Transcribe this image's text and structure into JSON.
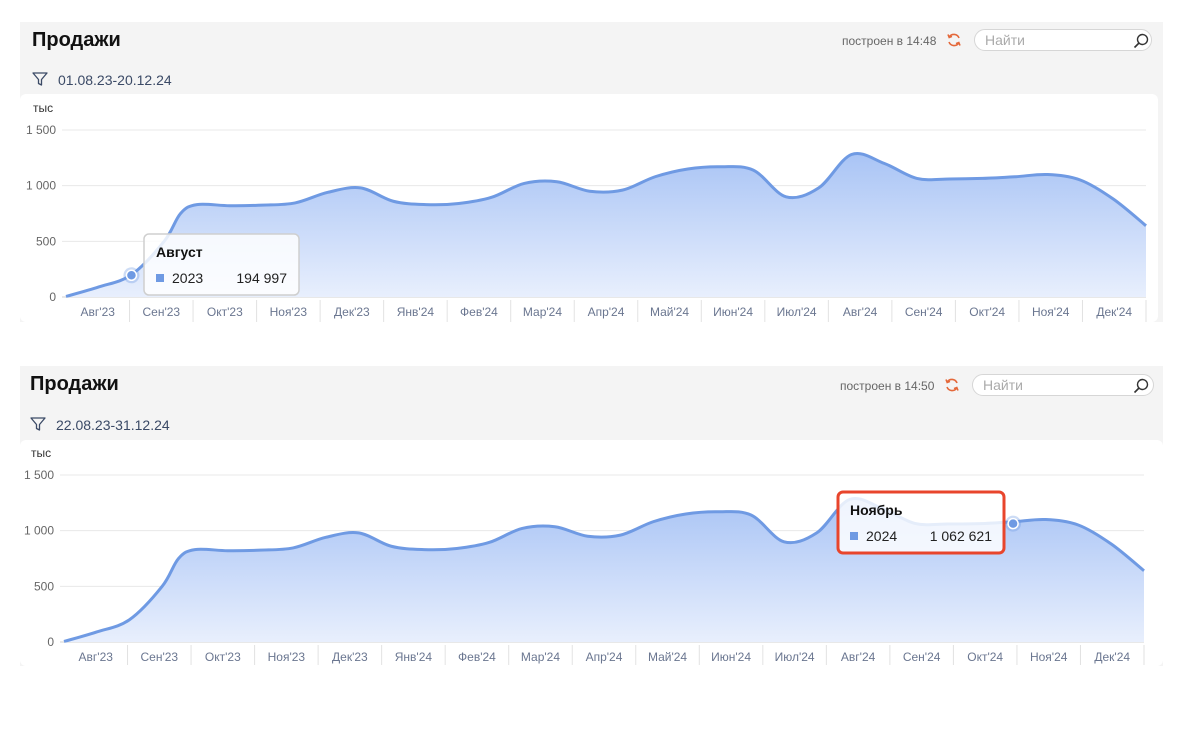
{
  "panels": [
    {
      "title": "Продажи",
      "built_label": "построен в 14:48",
      "search": {
        "placeholder": "Найти",
        "icon": "search-icon"
      },
      "refresh_icon": "refresh-icon",
      "filter_icon": "filter-icon",
      "date_range": "01.08.23-20.12.24",
      "tooltip": {
        "title": "Август",
        "series": "2023",
        "value": "194 997",
        "highlighted": false
      }
    },
    {
      "title": "Продажи",
      "built_label": "построен в 14:50",
      "search": {
        "placeholder": "Найти",
        "icon": "search-icon"
      },
      "refresh_icon": "refresh-icon",
      "filter_icon": "filter-icon",
      "date_range": "22.08.23-31.12.24",
      "tooltip": {
        "title": "Ноябрь",
        "series": "2024",
        "value": "1 062 621",
        "highlighted": true
      }
    }
  ],
  "colors": {
    "line": "#6f9ae3",
    "fill_top": "#a9c4f5",
    "fill_bottom": "#e8effd",
    "accent_refresh": "#e4683a",
    "highlight_border": "#e8452c"
  },
  "chart_data": [
    {
      "type": "area",
      "unit_label": "тыс",
      "categories": [
        "Авг'23",
        "Сен'23",
        "Окт'23",
        "Ноя'23",
        "Дек'23",
        "Янв'24",
        "Фев'24",
        "Мар'24",
        "Апр'24",
        "Май'24",
        "Июн'24",
        "Июл'24",
        "Авг'24",
        "Сен'24",
        "Окт'24",
        "Ноя'24",
        "Дек'24"
      ],
      "y_ticks": [
        "0",
        "500",
        "1 000",
        "1 500"
      ],
      "ylim": [
        0,
        1500
      ],
      "points": [
        {
          "x": 0.0,
          "y": 5
        },
        {
          "x": 0.5,
          "y": 90
        },
        {
          "x": 1.0,
          "y": 200
        },
        {
          "x": 1.5,
          "y": 500
        },
        {
          "x": 1.75,
          "y": 750
        },
        {
          "x": 2.0,
          "y": 830
        },
        {
          "x": 2.5,
          "y": 820
        },
        {
          "x": 3.0,
          "y": 825
        },
        {
          "x": 3.5,
          "y": 845
        },
        {
          "x": 4.0,
          "y": 940
        },
        {
          "x": 4.5,
          "y": 980
        },
        {
          "x": 5.0,
          "y": 860
        },
        {
          "x": 5.5,
          "y": 830
        },
        {
          "x": 6.0,
          "y": 840
        },
        {
          "x": 6.5,
          "y": 895
        },
        {
          "x": 7.0,
          "y": 1020
        },
        {
          "x": 7.5,
          "y": 1035
        },
        {
          "x": 8.0,
          "y": 950
        },
        {
          "x": 8.5,
          "y": 960
        },
        {
          "x": 9.0,
          "y": 1080
        },
        {
          "x": 9.5,
          "y": 1150
        },
        {
          "x": 10.0,
          "y": 1170
        },
        {
          "x": 10.5,
          "y": 1140
        },
        {
          "x": 11.0,
          "y": 900
        },
        {
          "x": 11.5,
          "y": 980
        },
        {
          "x": 12.0,
          "y": 1280
        },
        {
          "x": 12.5,
          "y": 1200
        },
        {
          "x": 13.0,
          "y": 1065
        },
        {
          "x": 13.5,
          "y": 1060
        },
        {
          "x": 14.0,
          "y": 1065
        },
        {
          "x": 14.5,
          "y": 1080
        },
        {
          "x": 15.0,
          "y": 1100
        },
        {
          "x": 15.5,
          "y": 1050
        },
        {
          "x": 16.0,
          "y": 880
        },
        {
          "x": 16.5,
          "y": 640
        }
      ],
      "x_domain": [
        0,
        16.5
      ],
      "marker": {
        "x": 1.0,
        "y": 195
      }
    },
    {
      "type": "area",
      "unit_label": "тыс",
      "categories": [
        "Авг'23",
        "Сен'23",
        "Окт'23",
        "Ноя'23",
        "Дек'23",
        "Янв'24",
        "Фев'24",
        "Мар'24",
        "Апр'24",
        "Май'24",
        "Июн'24",
        "Июл'24",
        "Авг'24",
        "Сен'24",
        "Окт'24",
        "Ноя'24",
        "Дек'24"
      ],
      "y_ticks": [
        "0",
        "500",
        "1 000",
        "1 500"
      ],
      "ylim": [
        0,
        1500
      ],
      "points": [
        {
          "x": 0.0,
          "y": 5
        },
        {
          "x": 0.5,
          "y": 90
        },
        {
          "x": 1.0,
          "y": 200
        },
        {
          "x": 1.5,
          "y": 500
        },
        {
          "x": 1.75,
          "y": 750
        },
        {
          "x": 2.0,
          "y": 830
        },
        {
          "x": 2.5,
          "y": 820
        },
        {
          "x": 3.0,
          "y": 825
        },
        {
          "x": 3.5,
          "y": 845
        },
        {
          "x": 4.0,
          "y": 940
        },
        {
          "x": 4.5,
          "y": 980
        },
        {
          "x": 5.0,
          "y": 860
        },
        {
          "x": 5.5,
          "y": 830
        },
        {
          "x": 6.0,
          "y": 840
        },
        {
          "x": 6.5,
          "y": 895
        },
        {
          "x": 7.0,
          "y": 1020
        },
        {
          "x": 7.5,
          "y": 1035
        },
        {
          "x": 8.0,
          "y": 950
        },
        {
          "x": 8.5,
          "y": 960
        },
        {
          "x": 9.0,
          "y": 1080
        },
        {
          "x": 9.5,
          "y": 1150
        },
        {
          "x": 10.0,
          "y": 1170
        },
        {
          "x": 10.5,
          "y": 1140
        },
        {
          "x": 11.0,
          "y": 900
        },
        {
          "x": 11.5,
          "y": 980
        },
        {
          "x": 12.0,
          "y": 1280
        },
        {
          "x": 12.5,
          "y": 1200
        },
        {
          "x": 13.0,
          "y": 1065
        },
        {
          "x": 13.5,
          "y": 1060
        },
        {
          "x": 14.0,
          "y": 1063
        },
        {
          "x": 14.5,
          "y": 1080
        },
        {
          "x": 15.0,
          "y": 1100
        },
        {
          "x": 15.5,
          "y": 1050
        },
        {
          "x": 16.0,
          "y": 880
        },
        {
          "x": 16.5,
          "y": 640
        }
      ],
      "x_domain": [
        0,
        16.5
      ],
      "marker": {
        "x": 14.5,
        "y": 1063
      }
    }
  ]
}
